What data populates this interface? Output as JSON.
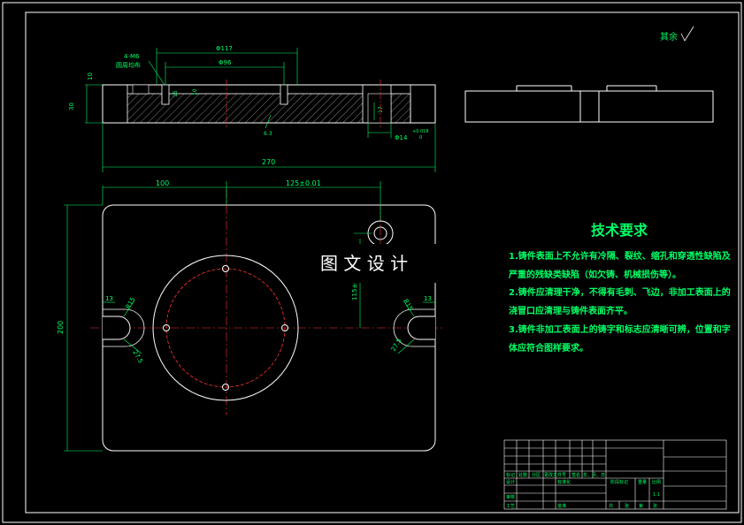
{
  "surface_note": "其余",
  "watermark": "图 文 设 计",
  "technical_requirements": {
    "title": "技术要求",
    "lines": [
      "1.铸件表面上不允许有冷隔、裂纹、缩孔和穿透性缺陷及",
      "严重的残缺类缺陷（如欠铸、机械损伤等）。",
      "2.铸件应清理干净，不得有毛刺、飞边，非加工表面上的",
      "浇冒口应清理与铸件表面齐平。",
      "3.铸件非加工表面上的铸字和标志应清晰可辨，位置和字",
      "体应符合图样要求。"
    ]
  },
  "dimensions": {
    "section_holes": "4-M6",
    "section_holes_note": "圆周均布",
    "phi117": "Φ117",
    "phi96": "Φ96",
    "h10": "10",
    "h30": "30",
    "d17": "17",
    "d14": "Φ14",
    "d14_tol": "+0.018 0",
    "d14_tol_top": "+0.018",
    "d14_tol_bot": "0",
    "t15": "15",
    "t10": "10",
    "ra": "6.3",
    "w270": "270",
    "w100": "100",
    "w125": "125±0.01",
    "h200": "200",
    "h115": "115±0.1",
    "r13_left": "13",
    "r13_right": "13",
    "R15_left": "R15",
    "R15_right": "R15",
    "l27_left": "27.5",
    "l27_right": "27.5"
  },
  "title_block": {
    "row1": [
      "标记",
      "处数",
      "分区",
      "更改文件号",
      "签名",
      "年、月、日"
    ],
    "row2": [
      "设计",
      "",
      "标准化"
    ],
    "row3": [
      "审核"
    ],
    "row4": [
      "工艺",
      "",
      "批准"
    ],
    "stage_labels": [
      "阶段标记",
      "重量",
      "比例"
    ],
    "scale": "1:1",
    "sheet": [
      "共",
      "张",
      "第",
      "张"
    ]
  }
}
